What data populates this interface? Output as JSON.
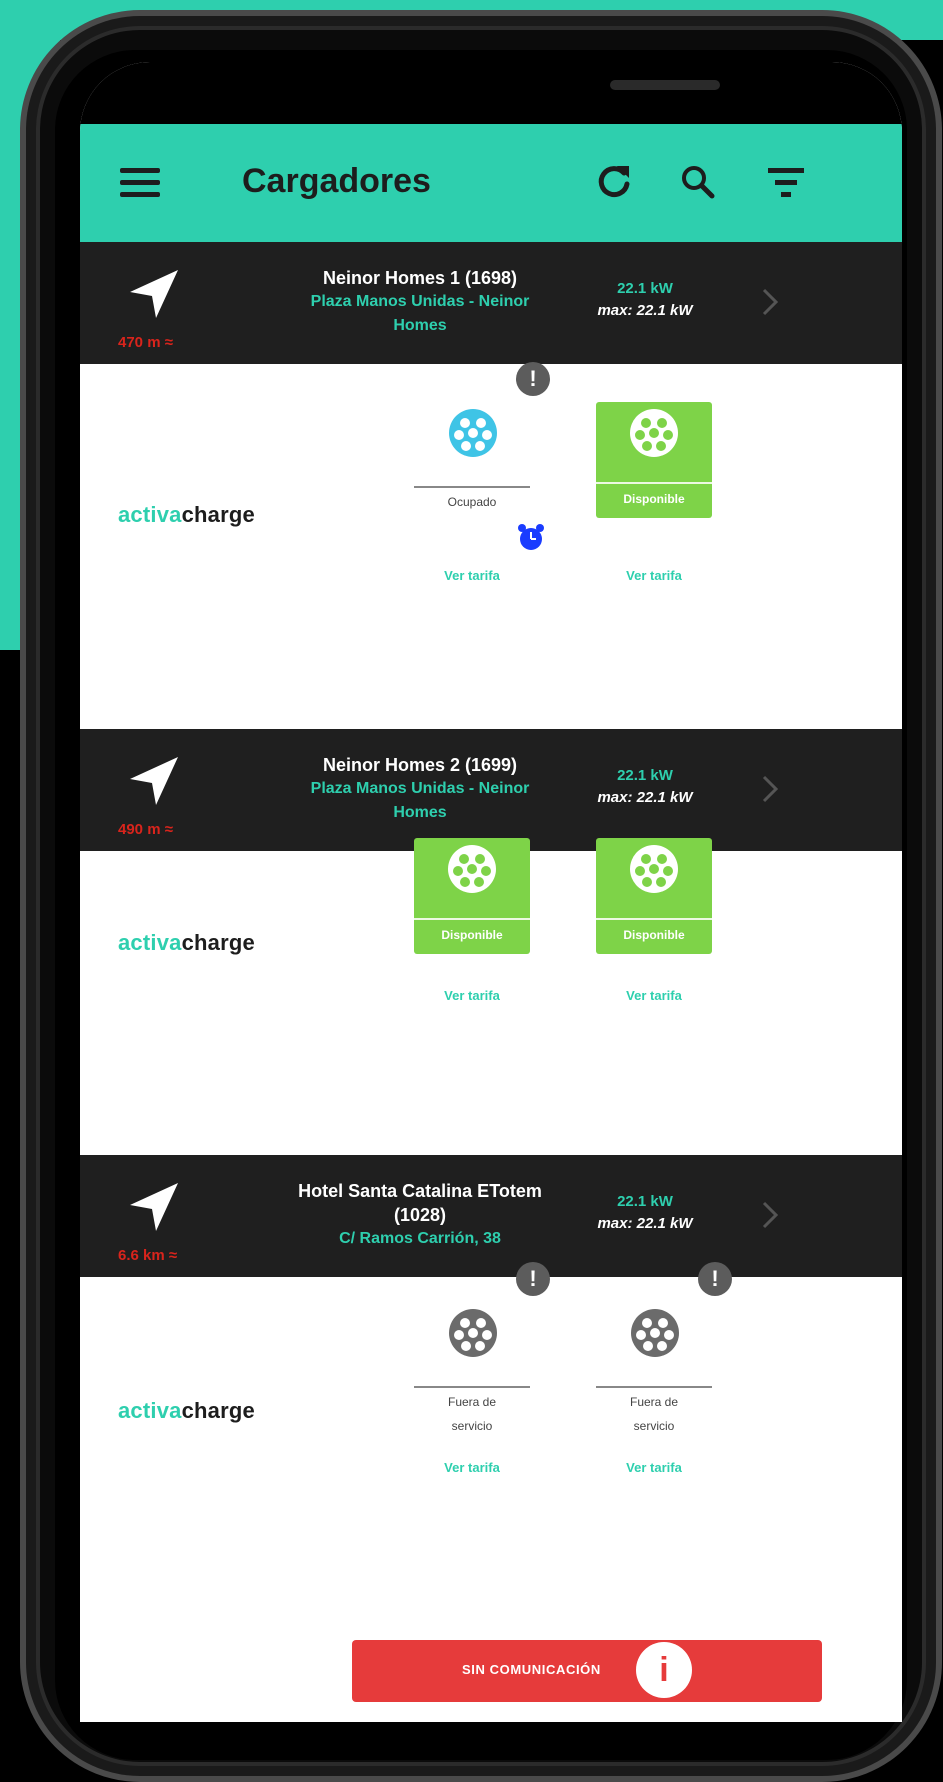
{
  "app": {
    "title": "Cargadores",
    "accent": "#2ecfae",
    "header_bg": "#1f1f1f",
    "status_colors": {
      "available": "#7ed348",
      "occupied": "#3fc4e6",
      "out_of_service": "#6b6b6b",
      "error": "#e63b3b"
    }
  },
  "toolbar": {
    "menu_icon": "hamburger-menu-icon",
    "refresh_icon": "refresh-icon",
    "search_icon": "search-icon",
    "filter_icon": "filter-icon"
  },
  "stations": [
    {
      "distance": "470 m ≈",
      "name": "Neinor Homes 1 (1698)",
      "address_line1": "Plaza Manos Unidas - Neinor",
      "address_line2": "Homes",
      "power": "22.1 kW",
      "max": "max: 22.1 kW",
      "operator_a": "activa",
      "operator_b": "charge",
      "connectors": [
        {
          "status": "Ocupado",
          "tarifa": "Ver tarifa"
        },
        {
          "status": "Disponible",
          "tarifa": "Ver tarifa"
        }
      ]
    },
    {
      "distance": "490 m ≈",
      "name": "Neinor Homes 2 (1699)",
      "address_line1": "Plaza Manos Unidas - Neinor",
      "address_line2": "Homes",
      "power": "22.1 kW",
      "max": "max: 22.1 kW",
      "operator_a": "activa",
      "operator_b": "charge",
      "connectors": [
        {
          "status": "Disponible",
          "tarifa": "Ver tarifa"
        },
        {
          "status": "Disponible",
          "tarifa": "Ver tarifa"
        }
      ]
    },
    {
      "distance": "6.6 km ≈",
      "name_line1": "Hotel Santa Catalina ETotem",
      "name_line2": "(1028)",
      "address_line1": "C/ Ramos Carrión, 38",
      "power": "22.1 kW",
      "max": "max: 22.1 kW",
      "operator_a": "activa",
      "operator_b": "charge",
      "connectors": [
        {
          "status_line1": "Fuera de",
          "status_line2": "servicio",
          "tarifa": "Ver tarifa"
        },
        {
          "status_line1": "Fuera de",
          "status_line2": "servicio",
          "tarifa": "Ver tarifa"
        }
      ]
    }
  ],
  "alert_button": {
    "label": "SIN COMUNICACIÓN",
    "icon_glyph": "i",
    "icon": "info-icon"
  },
  "warning_glyph": "!"
}
